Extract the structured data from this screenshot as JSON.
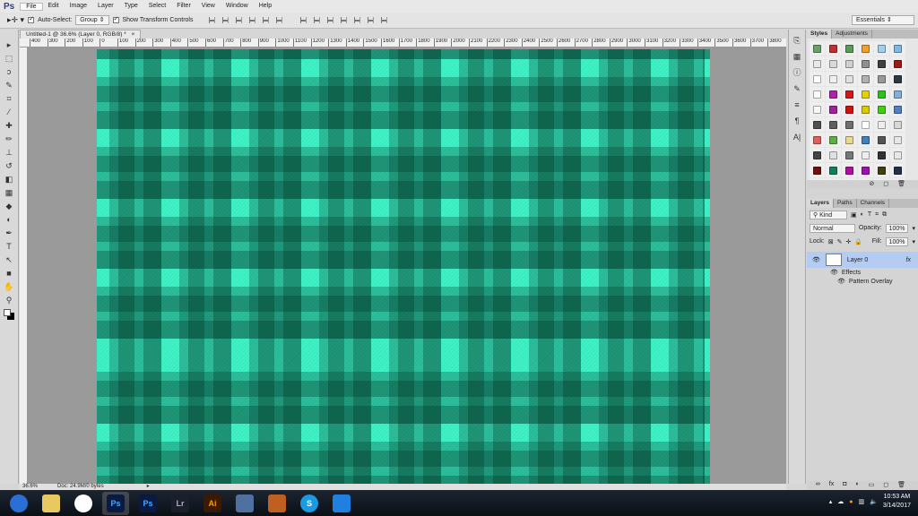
{
  "app": {
    "logo": "Ps"
  },
  "menu": [
    "File",
    "Edit",
    "Image",
    "Layer",
    "Type",
    "Select",
    "Filter",
    "View",
    "Window",
    "Help"
  ],
  "options": {
    "auto_select_label": "Auto-Select:",
    "auto_select_value": "Group",
    "show_transform_label": "Show Transform Controls",
    "workspace": "Essentials"
  },
  "document": {
    "tab_title": "Untitled-1 @ 36.6% (Layer 0, RGB/8) *",
    "close": "×",
    "zoom": "36.6%",
    "doc_info": "Doc: 24.9M/0 bytes"
  },
  "ruler_labels": [
    "400",
    "300",
    "200",
    "100",
    "0",
    "100",
    "200",
    "300",
    "400",
    "500",
    "600",
    "700",
    "800",
    "900",
    "1000",
    "1100",
    "1200",
    "1300",
    "1400",
    "1500",
    "1600",
    "1700",
    "1800",
    "1900",
    "2000",
    "2100",
    "2200",
    "2300",
    "2400",
    "2500",
    "2600",
    "2700",
    "2800",
    "2900",
    "3000",
    "3100",
    "3200",
    "3300",
    "3400",
    "3500",
    "3600",
    "3700",
    "3800"
  ],
  "tools": [
    "move-tool",
    "marquee-tool",
    "lasso-tool",
    "quick-select-tool",
    "crop-tool",
    "eyedropper-tool",
    "healing-tool",
    "brush-tool",
    "stamp-tool",
    "history-brush-tool",
    "eraser-tool",
    "gradient-tool",
    "blur-tool",
    "dodge-tool",
    "pen-tool",
    "type-tool",
    "path-select-tool",
    "shape-tool",
    "hand-tool",
    "zoom-tool"
  ],
  "tool_glyphs": [
    "▸",
    "⬚",
    "ↄ",
    "✎",
    "⌗",
    "⁄",
    "✚",
    "✏",
    "⊥",
    "↺",
    "◧",
    "▦",
    "◆",
    "◐",
    "✒",
    "T",
    "↖",
    "■",
    "✋",
    "⚲"
  ],
  "styles_panel": {
    "tabs": [
      "Styles",
      "Adjustments"
    ],
    "swatches": [
      "#6aa06a",
      "#c03030",
      "#5a9a5a",
      "#f0a030",
      "#a0d0f0",
      "#80b8e8",
      "#e8e8e8",
      "#d8d8d8",
      "#d0d0d0",
      "#909090",
      "#404040",
      "#a01818",
      "#ffffff",
      "#f0f0f0",
      "#e0e0e0",
      "#b0b0b0",
      "#999999",
      "#2a3a40",
      "#fafafa",
      "#b020b0",
      "#d01818",
      "#e0d010",
      "#30c020",
      "#80b0e0",
      "#f8f8f8",
      "#a020a0",
      "#d01010",
      "#d8c800",
      "#40d010",
      "#5080c0",
      "#505050",
      "#606060",
      "#707070",
      "#ffffff",
      "#eeeeee",
      "#d8d8d8",
      "#e06060",
      "#60b040",
      "#e8d890",
      "#4080c0",
      "#555555",
      "#e8e8e8",
      "#444444",
      "#e0e0e0",
      "#777777",
      "#eeeeee",
      "#333333",
      "#e8e8e8",
      "#701010",
      "#108060",
      "#b010a0",
      "#a010b0",
      "#404010",
      "#203050",
      "#102040",
      "#f0e0e0",
      "#d0a0a0",
      "#208080",
      "#303030",
      "#202020"
    ]
  },
  "layers_panel": {
    "tabs": [
      "Layers",
      "Paths",
      "Channels"
    ],
    "filter": "Kind",
    "blend_mode": "Normal",
    "opacity_label": "Opacity:",
    "opacity": "100%",
    "lock_label": "Lock:",
    "fill_label": "Fill:",
    "fill": "100%",
    "layer_name": "Layer 0",
    "fx": "fx",
    "effects_label": "Effects",
    "effect": "Pattern Overlay"
  },
  "canvas": {
    "base_color": "#3ff2c6",
    "dark_color": "#05604a"
  },
  "taskbar": {
    "apps": [
      "Start",
      "File Explorer",
      "Chrome",
      "Photoshop",
      "Photoshop",
      "Lightroom",
      "Illustrator",
      "App",
      "App",
      "Skype",
      "Screen Capture"
    ],
    "app_labels": [
      "",
      "",
      "",
      "Ps",
      "Ps",
      "Lr",
      "Ai",
      "",
      "",
      "S",
      ""
    ],
    "time": "10:53 AM",
    "date": "3/14/2017"
  }
}
